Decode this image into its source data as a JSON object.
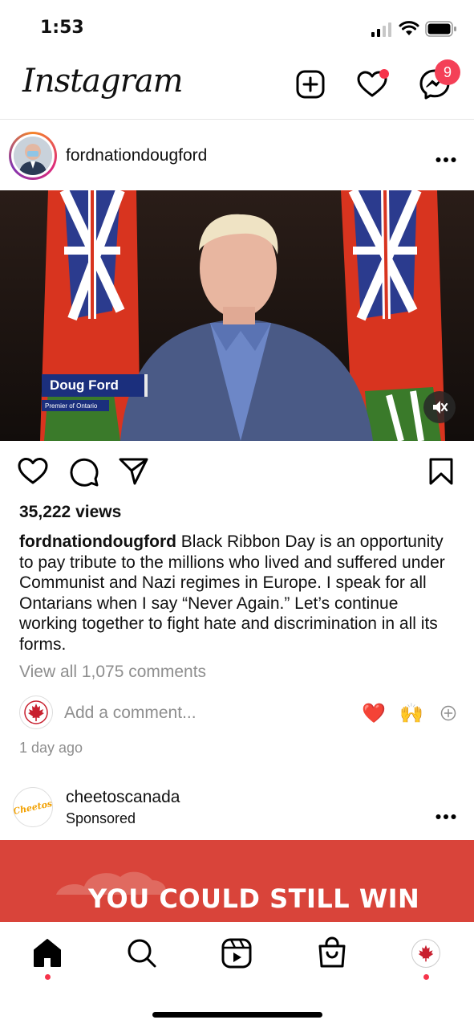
{
  "status_bar": {
    "time": "1:53"
  },
  "header": {
    "logo_text": "Instagram",
    "messenger_badge": "9"
  },
  "post": {
    "username": "fordnationdougford",
    "lower_third_name": "Doug Ford",
    "lower_third_title": "Premier of Ontario",
    "views": "35,222 views",
    "caption_username": "fordnationdougford",
    "caption_text": " Black Ribbon Day is an opportunity to pay tribute to the millions who lived and suffered under Communist and Nazi regimes in Europe. I speak for all Ontarians when I say “Never Again.” Let’s continue working together to fight hate and discrimination in all its forms.",
    "view_all_comments": "View all 1,075 comments",
    "comment_placeholder": "Add a comment...",
    "quick_reactions": [
      "❤️",
      "🙌"
    ],
    "posted_ago": "1 day ago"
  },
  "sponsored_post": {
    "username": "cheetoscanada",
    "sponsored_label": "Sponsored",
    "avatar_text": "Cheetos",
    "ad_headline": "YOU COULD STILL WIN"
  },
  "tab_bar": {
    "items": [
      "home-icon",
      "search-icon",
      "reels-icon",
      "shop-icon",
      "profile-avatar"
    ]
  },
  "colors": {
    "notification_red": "#f6344b",
    "text_secondary": "#8e8e8e",
    "ad_background": "#d9443a",
    "lower_third_blue": "#1b2f7d"
  }
}
